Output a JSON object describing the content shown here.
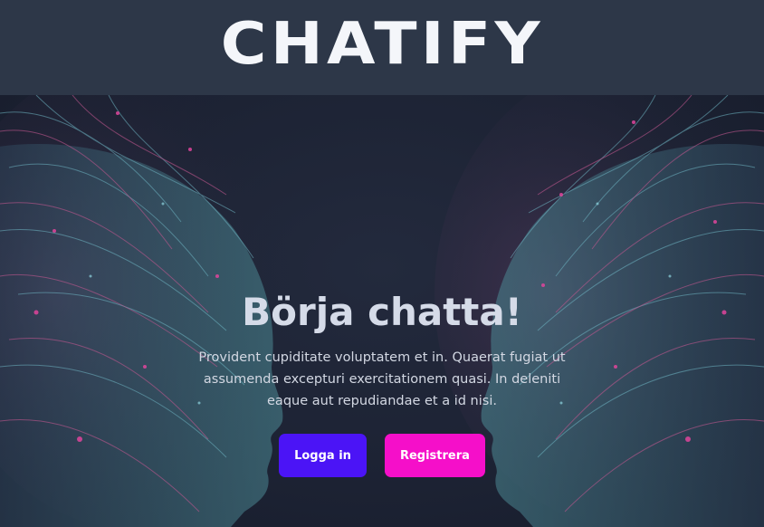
{
  "header": {
    "logo_text": "CHATIFY"
  },
  "hero": {
    "headline": "Börja chatta!",
    "lead": "Provident cupiditate voluptatem et in. Quaerat fugiat ut assumenda excepturi exercitationem quasi. In deleniti eaque aut repudiandae et a id nisi.",
    "login_label": "Logga in",
    "register_label": "Registrera",
    "background_image": "two-ai-faces-neural-network-art"
  },
  "colors": {
    "header_bg": "#2d3748",
    "hero_bg": "#1f2536",
    "headline": "#d5dbe8",
    "login_button": "#4b14f6",
    "register_button": "#f50fc9"
  }
}
